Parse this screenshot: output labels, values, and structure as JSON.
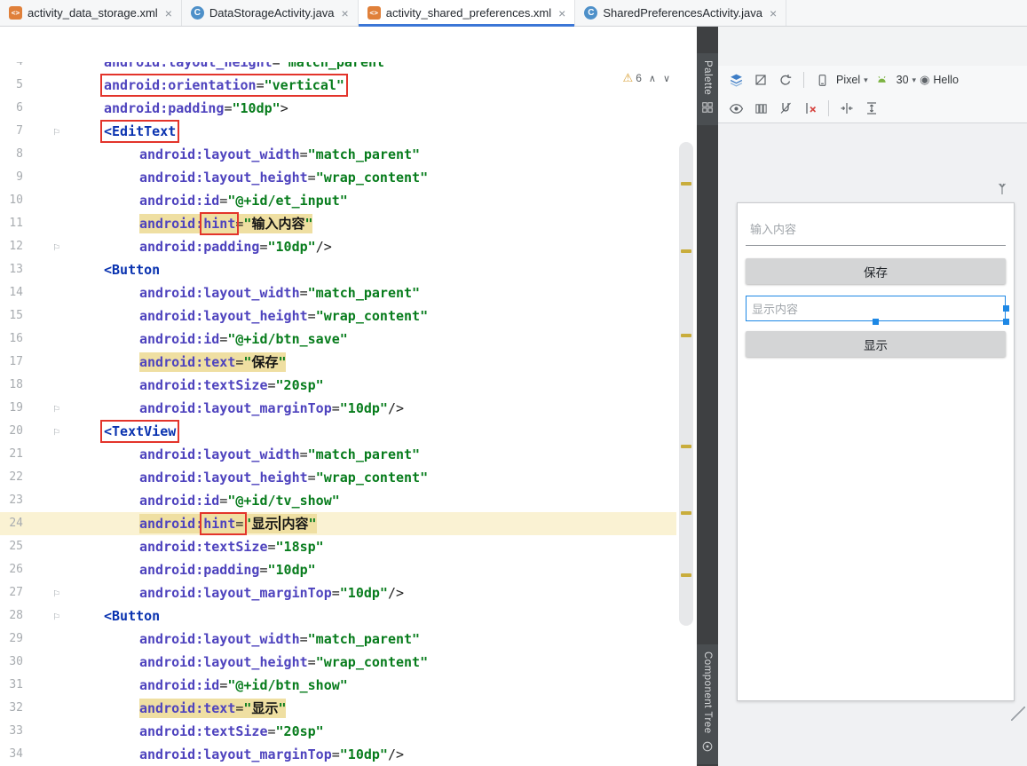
{
  "tabs": [
    {
      "label": "activity_data_storage.xml",
      "type": "xml"
    },
    {
      "label": "DataStorageActivity.java",
      "type": "class"
    },
    {
      "label": "activity_shared_preferences.xml",
      "type": "xml",
      "active": true
    },
    {
      "label": "SharedPreferencesActivity.java",
      "type": "class"
    }
  ],
  "icons": {
    "xml_file": "<>",
    "java_class": "C",
    "close": "×",
    "warning": "⚠",
    "prev": "∧",
    "next": "∨",
    "gutter_flag": "⚐",
    "dropdown": "▾",
    "theme": "◉"
  },
  "strips": {
    "palette": "Palette",
    "component_tree": "Component Tree"
  },
  "editor": {
    "warnings": {
      "count": "6"
    },
    "stripe_marks": [
      205,
      281,
      376,
      501,
      576,
      646
    ],
    "lines": [
      {
        "n": 4,
        "ind": 1,
        "clip": true,
        "segs": [
          [
            "a",
            "android:layout_height"
          ],
          [
            "e",
            "="
          ],
          [
            "v",
            "\"match_parent\""
          ]
        ]
      },
      {
        "n": 5,
        "ind": 1,
        "box": [
          0,
          2
        ],
        "segs": [
          [
            "a",
            "android:orientation"
          ],
          [
            "e",
            "="
          ],
          [
            "v",
            "\"vertical\""
          ]
        ]
      },
      {
        "n": 6,
        "ind": 1,
        "segs": [
          [
            "a",
            "android:padding"
          ],
          [
            "e",
            "="
          ],
          [
            "v",
            "\"10dp\""
          ],
          [
            "p",
            ">"
          ]
        ]
      },
      {
        "n": 7,
        "ind": 1,
        "mk": true,
        "box": [
          0,
          0
        ],
        "segs": [
          [
            "t",
            "<EditText"
          ]
        ]
      },
      {
        "n": 8,
        "ind": 2,
        "segs": [
          [
            "a",
            "android:layout_width"
          ],
          [
            "e",
            "="
          ],
          [
            "v",
            "\"match_parent\""
          ]
        ]
      },
      {
        "n": 9,
        "ind": 2,
        "segs": [
          [
            "a",
            "android:layout_height"
          ],
          [
            "e",
            "="
          ],
          [
            "v",
            "\"wrap_content\""
          ]
        ]
      },
      {
        "n": 10,
        "ind": 2,
        "segs": [
          [
            "a",
            "android:id"
          ],
          [
            "e",
            "="
          ],
          [
            "v",
            "\"@+id/et_input\""
          ]
        ]
      },
      {
        "n": 11,
        "ind": 2,
        "hl": [
          0,
          5
        ],
        "box": [
          1,
          1
        ],
        "segs": [
          [
            "a",
            "android:"
          ],
          [
            "a",
            "hint"
          ],
          [
            "e",
            "="
          ],
          [
            "q",
            "\""
          ],
          [
            "c",
            "输入内容"
          ],
          [
            "q",
            "\""
          ]
        ]
      },
      {
        "n": 12,
        "ind": 2,
        "mk": true,
        "segs": [
          [
            "a",
            "android:padding"
          ],
          [
            "e",
            "="
          ],
          [
            "v",
            "\"10dp\""
          ],
          [
            "p",
            "/>"
          ]
        ]
      },
      {
        "n": 13,
        "ind": 1,
        "segs": [
          [
            "t",
            "<Button"
          ]
        ]
      },
      {
        "n": 14,
        "ind": 2,
        "segs": [
          [
            "a",
            "android:layout_width"
          ],
          [
            "e",
            "="
          ],
          [
            "v",
            "\"match_parent\""
          ]
        ]
      },
      {
        "n": 15,
        "ind": 2,
        "segs": [
          [
            "a",
            "android:layout_height"
          ],
          [
            "e",
            "="
          ],
          [
            "v",
            "\"wrap_content\""
          ]
        ]
      },
      {
        "n": 16,
        "ind": 2,
        "segs": [
          [
            "a",
            "android:id"
          ],
          [
            "e",
            "="
          ],
          [
            "v",
            "\"@+id/btn_save\""
          ]
        ]
      },
      {
        "n": 17,
        "ind": 2,
        "hl": [
          0,
          4
        ],
        "segs": [
          [
            "a",
            "android:text"
          ],
          [
            "e",
            "="
          ],
          [
            "q",
            "\""
          ],
          [
            "c",
            "保存"
          ],
          [
            "q",
            "\""
          ]
        ]
      },
      {
        "n": 18,
        "ind": 2,
        "segs": [
          [
            "a",
            "android:textSize"
          ],
          [
            "e",
            "="
          ],
          [
            "v",
            "\"20sp\""
          ]
        ]
      },
      {
        "n": 19,
        "ind": 2,
        "mk": true,
        "segs": [
          [
            "a",
            "android:layout_marginTop"
          ],
          [
            "e",
            "="
          ],
          [
            "v",
            "\"10dp\""
          ],
          [
            "p",
            "/>"
          ]
        ]
      },
      {
        "n": 20,
        "ind": 1,
        "mk": true,
        "box": [
          0,
          0
        ],
        "segs": [
          [
            "t",
            "<TextView"
          ]
        ]
      },
      {
        "n": 21,
        "ind": 2,
        "segs": [
          [
            "a",
            "android:layout_width"
          ],
          [
            "e",
            "="
          ],
          [
            "v",
            "\"match_parent\""
          ]
        ]
      },
      {
        "n": 22,
        "ind": 2,
        "segs": [
          [
            "a",
            "android:layout_height"
          ],
          [
            "e",
            "="
          ],
          [
            "v",
            "\"wrap_content\""
          ]
        ]
      },
      {
        "n": 23,
        "ind": 2,
        "segs": [
          [
            "a",
            "android:id"
          ],
          [
            "e",
            "="
          ],
          [
            "v",
            "\"@+id/tv_show\""
          ]
        ]
      },
      {
        "n": 24,
        "ind": 2,
        "cur": true,
        "hl": [
          0,
          7
        ],
        "box": [
          1,
          2
        ],
        "segs": [
          [
            "a",
            "android:"
          ],
          [
            "a",
            "hint"
          ],
          [
            "e",
            "="
          ],
          [
            "q",
            "\""
          ],
          [
            "c",
            "显示"
          ],
          [
            "k",
            ""
          ],
          [
            "c",
            "内容"
          ],
          [
            "q",
            "\""
          ]
        ]
      },
      {
        "n": 25,
        "ind": 2,
        "segs": [
          [
            "a",
            "android:textSize"
          ],
          [
            "e",
            "="
          ],
          [
            "v",
            "\"18sp\""
          ]
        ]
      },
      {
        "n": 26,
        "ind": 2,
        "segs": [
          [
            "a",
            "android:padding"
          ],
          [
            "e",
            "="
          ],
          [
            "v",
            "\"10dp\""
          ]
        ]
      },
      {
        "n": 27,
        "ind": 2,
        "mk": true,
        "segs": [
          [
            "a",
            "android:layout_marginTop"
          ],
          [
            "e",
            "="
          ],
          [
            "v",
            "\"10dp\""
          ],
          [
            "p",
            "/>"
          ]
        ]
      },
      {
        "n": 28,
        "ind": 1,
        "mk": true,
        "segs": [
          [
            "t",
            "<Button"
          ]
        ]
      },
      {
        "n": 29,
        "ind": 2,
        "segs": [
          [
            "a",
            "android:layout_width"
          ],
          [
            "e",
            "="
          ],
          [
            "v",
            "\"match_parent\""
          ]
        ]
      },
      {
        "n": 30,
        "ind": 2,
        "segs": [
          [
            "a",
            "android:layout_height"
          ],
          [
            "e",
            "="
          ],
          [
            "v",
            "\"wrap_content\""
          ]
        ]
      },
      {
        "n": 31,
        "ind": 2,
        "segs": [
          [
            "a",
            "android:id"
          ],
          [
            "e",
            "="
          ],
          [
            "v",
            "\"@+id/btn_show\""
          ]
        ]
      },
      {
        "n": 32,
        "ind": 2,
        "hl": [
          0,
          4
        ],
        "segs": [
          [
            "a",
            "android:text"
          ],
          [
            "e",
            "="
          ],
          [
            "q",
            "\""
          ],
          [
            "c",
            "显示"
          ],
          [
            "q",
            "\""
          ]
        ]
      },
      {
        "n": 33,
        "ind": 2,
        "segs": [
          [
            "a",
            "android:textSize"
          ],
          [
            "e",
            "="
          ],
          [
            "v",
            "\"20sp\""
          ]
        ]
      },
      {
        "n": 34,
        "ind": 2,
        "segs": [
          [
            "a",
            "android:layout_marginTop"
          ],
          [
            "e",
            "="
          ],
          [
            "v",
            "\"10dp\""
          ],
          [
            "p",
            "/>"
          ]
        ]
      }
    ]
  },
  "design": {
    "toolbar_top": {
      "device": "Pixel",
      "api": "30",
      "theme": "Hello"
    },
    "preview": {
      "edittext_hint": "输入内容",
      "save_button_label": "保存",
      "textview_hint": "显示内容",
      "show_button_label": "显示"
    }
  }
}
